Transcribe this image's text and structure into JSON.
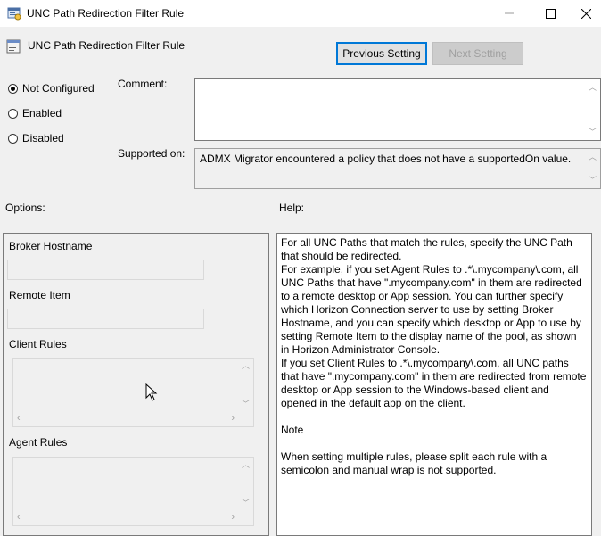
{
  "window": {
    "title": "UNC Path Redirection Filter Rule",
    "minimize_icon": "minimize-icon",
    "maximize_icon": "maximize-icon",
    "close_icon": "close-icon"
  },
  "header": {
    "setting_title": "UNC Path Redirection Filter Rule",
    "previous_button": "Previous Setting",
    "next_button": "Next Setting"
  },
  "state": {
    "options": [
      {
        "label": "Not Configured",
        "checked": true
      },
      {
        "label": "Enabled",
        "checked": false
      },
      {
        "label": "Disabled",
        "checked": false
      }
    ]
  },
  "comment": {
    "label": "Comment:",
    "value": ""
  },
  "supported": {
    "label": "Supported on:",
    "value": "ADMX Migrator encountered a policy that does not have a supportedOn value."
  },
  "options_panel": {
    "label": "Options:",
    "broker_hostname_label": "Broker Hostname",
    "broker_hostname_value": "",
    "remote_item_label": "Remote Item",
    "remote_item_value": "",
    "client_rules_label": "Client Rules",
    "client_rules_value": "",
    "agent_rules_label": "Agent Rules",
    "agent_rules_value": ""
  },
  "help_panel": {
    "label": "Help:",
    "lines": [
      "For all UNC Paths that match the rules, specify the UNC Path that should be redirected.",
      "For example, if you set Agent Rules to .*\\.mycompany\\.com, all UNC Paths that have \".mycompany.com\" in them are redirected to a remote desktop or App session. You can further specify which Horizon Connection server to use by setting Broker Hostname, and you can specify which desktop or App to use by setting Remote Item to the display name of the pool, as shown in Horizon Administrator Console.",
      "If you set Client Rules to .*\\.mycompany\\.com, all UNC paths that have \".mycompany.com\" in them are redirected from remote desktop or App session to the Windows-based client and opened in the default app on the client.",
      "",
      "Note",
      "",
      "When setting multiple rules, please split each rule with a semicolon and manual wrap is not supported."
    ]
  }
}
